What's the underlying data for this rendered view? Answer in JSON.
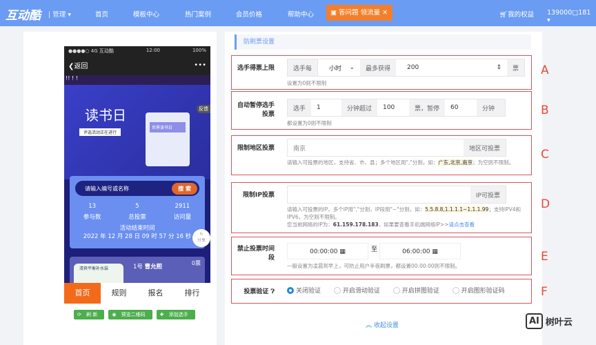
{
  "header": {
    "logo": "互动酷",
    "manage": "管理",
    "nav": [
      "首页",
      "模板中心",
      "热门案例",
      "会员价格",
      "帮助中心"
    ],
    "ad": "答问题 领流量",
    "rights": "我的权益",
    "user": "139000□181"
  },
  "phone": {
    "status": {
      "carrier": "●●●●○ 4G  互动酷",
      "time": "12:00",
      "battery": "100%"
    },
    "back": "返回",
    "more": "•••",
    "marquee": "!! ! !",
    "title": "读书日",
    "subtitle": "评选活动正在进行",
    "scroll": "世界读书日",
    "report": "反馈",
    "search_placeholder": "请输入编号或名称",
    "search_btn": "搜 索",
    "stats": [
      {
        "value": "13",
        "label": "参与数"
      },
      {
        "value": "5",
        "label": "总投票"
      },
      {
        "value": "2911",
        "label": "访问量"
      }
    ],
    "end_label": "活动结束时间",
    "end_time": "2022 年 12 月 28 日 09 时 57 分 16 秒",
    "share": "分享",
    "candidate": {
      "no": "1号",
      "name": "曹允熙",
      "votes": "0票",
      "img_text": "清爽平衡补水装"
    },
    "tabs": [
      "首页",
      "规则",
      "报名",
      "排行"
    ]
  },
  "actions": [
    "刷 新",
    "预览二维码",
    "添加选手"
  ],
  "section_title": "防刷票设置",
  "a": {
    "label": "选手得票上限",
    "p1": "选手每",
    "unit": "小时",
    "p2": "最多获得",
    "value": "200",
    "suffix": "票",
    "hint": "设置为0则不限制"
  },
  "b": {
    "label1": "自动暂停选手",
    "label2": "投票",
    "p1": "选手",
    "v1": "1",
    "p2": "分钟超过",
    "v2": "100",
    "p3": "票，暂停",
    "v3": "60",
    "p4": "分钟",
    "hint": "都设置为0则不限制"
  },
  "c": {
    "label": "限制地区投票",
    "value": "南京",
    "suffix": "地区可投票",
    "hint1": "请输入可投票的地区，支持省、市、县；多个地区用\",\"分割，如：",
    "example": "广东,北京,南京",
    "hint2": "；为空则不限制。"
  },
  "d": {
    "label": "限制IP投票",
    "value": "",
    "suffix": "IP可投票",
    "hint1": "请输入可投票的IP，多个IP用\",\"分割，IP段用\"~\"分割，如：",
    "example": "5.5.8.8,1.1.1.1~1.1.1.99",
    "hint2": "；支持IPV4和IPV6，为空则不限制。",
    "ip_prefix": "您当前网络的IP为：",
    "ip": "61.159.178.183",
    "ip_suffix": "，如果要查看手机端网络IP>>",
    "link": "请点击查看"
  },
  "e": {
    "label1": "禁止投票时间",
    "label2": "段",
    "from": "00:00:00",
    "to_label": "至",
    "to": "06:00:00",
    "hint": "一般设置为凌晨到早上，可防止用户半夜刷票，都设置00:00:00则不限制。"
  },
  "f": {
    "label": "投票验证",
    "options": [
      "关闭验证",
      "开启滑动验证",
      "开启拼图验证",
      "开启图形验证码"
    ]
  },
  "collapse": "收起设置",
  "markers": [
    "A",
    "B",
    "C",
    "D",
    "E",
    "F"
  ],
  "watermark": "树叶云"
}
